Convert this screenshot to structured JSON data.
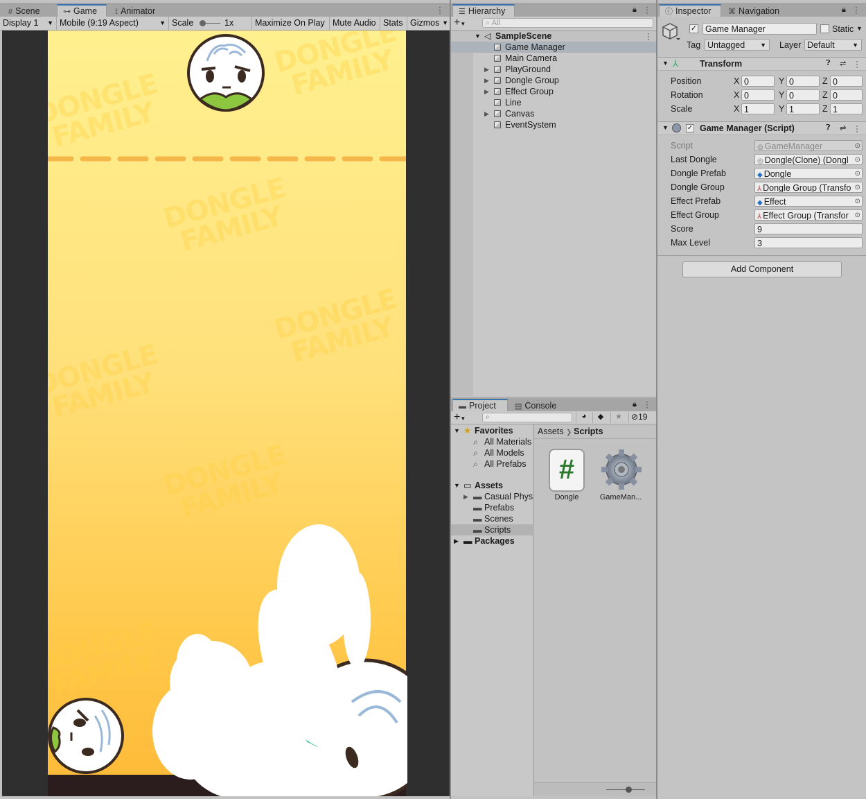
{
  "scene_panel": {
    "tabs": [
      {
        "label": "Scene",
        "icon": "grid-icon"
      },
      {
        "label": "Game",
        "icon": "gamepad-icon"
      },
      {
        "label": "Animator",
        "icon": "animator-icon"
      }
    ],
    "toolbar": {
      "display": "Display 1",
      "aspect": "Mobile (9:19 Aspect)",
      "scale_label": "Scale",
      "scale_value": "1x",
      "maximize": "Maximize On Play",
      "mute": "Mute Audio",
      "stats": "Stats",
      "gizmos": "Gizmos"
    },
    "watermark_line1": "DONGLE",
    "watermark_line2": "FAMILY"
  },
  "hierarchy": {
    "tab": "Hierarchy",
    "search_placeholder": "All",
    "scene": "SampleScene",
    "items": [
      {
        "label": "Game Manager",
        "expandable": false,
        "selected": true
      },
      {
        "label": "Main Camera",
        "expandable": false
      },
      {
        "label": "PlayGround",
        "expandable": true
      },
      {
        "label": "Dongle Group",
        "expandable": true
      },
      {
        "label": "Effect Group",
        "expandable": true
      },
      {
        "label": "Line",
        "expandable": false
      },
      {
        "label": "Canvas",
        "expandable": true
      },
      {
        "label": "EventSystem",
        "expandable": false
      }
    ]
  },
  "project": {
    "tabs": [
      "Project",
      "Console"
    ],
    "hidden_count": "19",
    "favorites_label": "Favorites",
    "favorites": [
      "All Materials",
      "All Models",
      "All Prefabs"
    ],
    "assets_label": "Assets",
    "asset_folders": [
      "Casual Phys",
      "Prefabs",
      "Scenes",
      "Scripts"
    ],
    "packages_label": "Packages",
    "breadcrumb": [
      "Assets",
      "Scripts"
    ],
    "files": [
      {
        "name": "Dongle",
        "icon": "csharp-script-icon"
      },
      {
        "name": "GameMan...",
        "icon": "gear-script-icon"
      }
    ]
  },
  "inspector": {
    "tabs": [
      "Inspector",
      "Navigation"
    ],
    "object_name": "Game Manager",
    "static_label": "Static",
    "tag_label": "Tag",
    "tag_value": "Untagged",
    "layer_label": "Layer",
    "layer_value": "Default",
    "transform": {
      "title": "Transform",
      "rows": [
        {
          "label": "Position",
          "x": "0",
          "y": "0",
          "z": "0"
        },
        {
          "label": "Rotation",
          "x": "0",
          "y": "0",
          "z": "0"
        },
        {
          "label": "Scale",
          "x": "1",
          "y": "1",
          "z": "1"
        }
      ]
    },
    "script": {
      "title": "Game Manager (Script)",
      "fields": [
        {
          "label": "Script",
          "value": "GameManager",
          "icon": "script-icon",
          "disabled": true
        },
        {
          "label": "Last Dongle",
          "value": "Dongle(Clone) (Dongl",
          "icon": "script-icon"
        },
        {
          "label": "Dongle Prefab",
          "value": "Dongle",
          "icon": "prefab-icon"
        },
        {
          "label": "Dongle Group",
          "value": "Dongle Group (Transfo",
          "icon": "transform-icon"
        },
        {
          "label": "Effect Prefab",
          "value": "Effect",
          "icon": "prefab-icon"
        },
        {
          "label": "Effect Group",
          "value": "Effect Group (Transfor",
          "icon": "transform-icon"
        },
        {
          "label": "Score",
          "value": "9"
        },
        {
          "label": "Max Level",
          "value": "3"
        }
      ]
    },
    "add_component": "Add Component"
  }
}
